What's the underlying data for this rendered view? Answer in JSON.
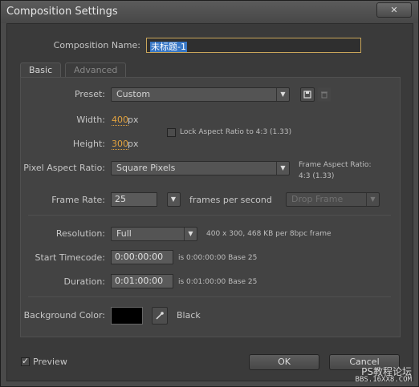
{
  "window": {
    "title": "Composition Settings",
    "close_label": "✕"
  },
  "composition_name": {
    "label": "Composition Name:",
    "value": "未标题-1"
  },
  "tabs": [
    {
      "label": "Basic",
      "active": true
    },
    {
      "label": "Advanced",
      "active": false
    }
  ],
  "preset": {
    "label": "Preset:",
    "value": "Custom"
  },
  "width": {
    "label": "Width:",
    "value": "400",
    "unit": "px"
  },
  "height": {
    "label": "Height:",
    "value": "300",
    "unit": "px"
  },
  "lock_aspect": {
    "label": "Lock Aspect Ratio to 4:3 (1.33)",
    "checked": false
  },
  "pixel_aspect": {
    "label": "Pixel Aspect Ratio:",
    "value": "Square Pixels",
    "frame_aspect_label": "Frame Aspect Ratio:",
    "frame_aspect_value": "4:3 (1.33)"
  },
  "frame_rate": {
    "label": "Frame Rate:",
    "value": "25",
    "unit": "frames per second",
    "drop_frame": "Drop Frame"
  },
  "resolution": {
    "label": "Resolution:",
    "value": "Full",
    "info": "400 x 300, 468 KB per 8bpc frame"
  },
  "start_timecode": {
    "label": "Start Timecode:",
    "value": "0:00:00:00",
    "info": "is 0:00:00:00  Base 25"
  },
  "duration": {
    "label": "Duration:",
    "value": "0:01:00:00",
    "info": "is 0:01:00:00  Base 25"
  },
  "background": {
    "label": "Background Color:",
    "color": "#000000",
    "name": "Black"
  },
  "preview": {
    "label": "Preview",
    "checked": true
  },
  "buttons": {
    "ok": "OK",
    "cancel": "Cancel"
  },
  "watermark": {
    "line1": "PS教程论坛",
    "line2": "BBS.16XX8.COM"
  }
}
